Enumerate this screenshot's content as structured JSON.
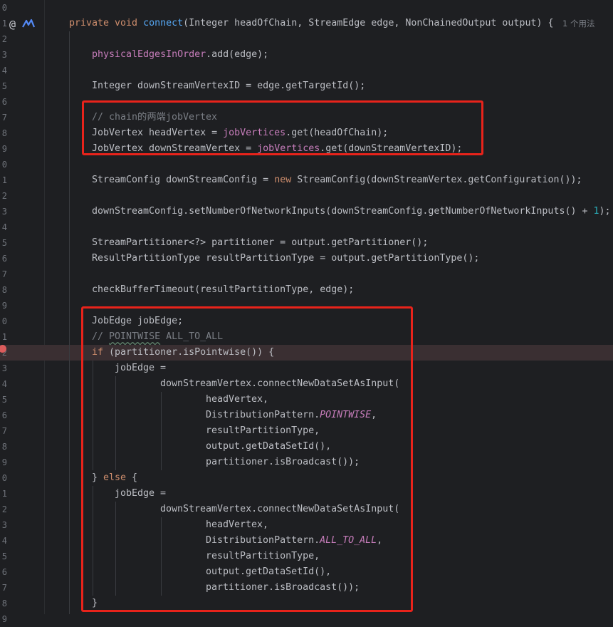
{
  "editor": {
    "usage_hint": "1 个用法",
    "lines": [
      {
        "no": "0",
        "indent": 0,
        "tokens": []
      },
      {
        "no": "1",
        "indent": 1,
        "tokens": [
          {
            "t": "k",
            "v": "private void "
          },
          {
            "t": "f",
            "v": "connect"
          },
          {
            "t": "",
            "v": "(Integer headOfChain, StreamEdge edge, NonChainedOutput output) {"
          }
        ]
      },
      {
        "no": "2",
        "indent": 0,
        "tokens": []
      },
      {
        "no": "3",
        "indent": 2,
        "tokens": [
          {
            "t": "p",
            "v": "physicalEdgesInOrder"
          },
          {
            "t": "",
            "v": ".add(edge);"
          }
        ]
      },
      {
        "no": "4",
        "indent": 0,
        "tokens": []
      },
      {
        "no": "5",
        "indent": 2,
        "tokens": [
          {
            "t": "",
            "v": "Integer downStreamVertexID = edge.getTargetId();"
          }
        ]
      },
      {
        "no": "6",
        "indent": 0,
        "tokens": []
      },
      {
        "no": "7",
        "indent": 2,
        "tokens": [
          {
            "t": "c",
            "v": "// chain的两端jobVertex"
          }
        ]
      },
      {
        "no": "8",
        "indent": 2,
        "tokens": [
          {
            "t": "",
            "v": "JobVertex headVertex = "
          },
          {
            "t": "p",
            "v": "jobVertices"
          },
          {
            "t": "",
            "v": ".get(headOfChain);"
          }
        ]
      },
      {
        "no": "9",
        "indent": 2,
        "tokens": [
          {
            "t": "",
            "v": "JobVertex downStreamVertex = "
          },
          {
            "t": "p",
            "v": "jobVertices"
          },
          {
            "t": "",
            "v": ".get(downStreamVertexID);"
          }
        ]
      },
      {
        "no": "0",
        "indent": 0,
        "tokens": []
      },
      {
        "no": "1",
        "indent": 2,
        "tokens": [
          {
            "t": "",
            "v": "StreamConfig downStreamConfig = "
          },
          {
            "t": "k",
            "v": "new "
          },
          {
            "t": "",
            "v": "StreamConfig(downStreamVertex.getConfiguration());"
          }
        ]
      },
      {
        "no": "2",
        "indent": 0,
        "tokens": []
      },
      {
        "no": "3",
        "indent": 2,
        "tokens": [
          {
            "t": "",
            "v": "downStreamConfig.setNumberOfNetworkInputs(downStreamConfig.getNumberOfNetworkInputs() + "
          },
          {
            "t": "n",
            "v": "1"
          },
          {
            "t": "",
            "v": ");"
          }
        ]
      },
      {
        "no": "4",
        "indent": 0,
        "tokens": []
      },
      {
        "no": "5",
        "indent": 2,
        "tokens": [
          {
            "t": "",
            "v": "StreamPartitioner<?> partitioner = output.getPartitioner();"
          }
        ]
      },
      {
        "no": "6",
        "indent": 2,
        "tokens": [
          {
            "t": "",
            "v": "ResultPartitionType resultPartitionType = output.getPartitionType();"
          }
        ]
      },
      {
        "no": "7",
        "indent": 0,
        "tokens": []
      },
      {
        "no": "8",
        "indent": 2,
        "tokens": [
          {
            "t": "",
            "v": "checkBufferTimeout(resultPartitionType, edge);"
          }
        ]
      },
      {
        "no": "9",
        "indent": 0,
        "tokens": []
      },
      {
        "no": "0",
        "indent": 2,
        "tokens": [
          {
            "t": "",
            "v": "JobEdge jobEdge;"
          }
        ]
      },
      {
        "no": "1",
        "indent": 2,
        "tokens": [
          {
            "t": "c",
            "v": "// "
          },
          {
            "t": "c wave",
            "v": "POINTWISE"
          },
          {
            "t": "c",
            "v": " ALL_TO_ALL"
          }
        ]
      },
      {
        "no": "2",
        "indent": 2,
        "active": true,
        "tokens": [
          {
            "t": "k",
            "v": "if "
          },
          {
            "t": "",
            "v": "(partitioner.isPointwise()) {"
          }
        ]
      },
      {
        "no": "3",
        "indent": 3,
        "tokens": [
          {
            "t": "",
            "v": "jobEdge ="
          }
        ]
      },
      {
        "no": "4",
        "indent": 5,
        "tokens": [
          {
            "t": "",
            "v": "downStreamVertex.connectNewDataSetAsInput("
          }
        ]
      },
      {
        "no": "5",
        "indent": 7,
        "tokens": [
          {
            "t": "",
            "v": "headVertex,"
          }
        ]
      },
      {
        "no": "6",
        "indent": 7,
        "tokens": [
          {
            "t": "",
            "v": "DistributionPattern."
          },
          {
            "t": "s",
            "v": "POINTWISE"
          },
          {
            "t": "",
            "v": ","
          }
        ]
      },
      {
        "no": "7",
        "indent": 7,
        "tokens": [
          {
            "t": "",
            "v": "resultPartitionType,"
          }
        ]
      },
      {
        "no": "8",
        "indent": 7,
        "tokens": [
          {
            "t": "",
            "v": "output.getDataSetId(),"
          }
        ]
      },
      {
        "no": "9",
        "indent": 7,
        "tokens": [
          {
            "t": "",
            "v": "partitioner.isBroadcast());"
          }
        ]
      },
      {
        "no": "0",
        "indent": 2,
        "tokens": [
          {
            "t": "",
            "v": "} "
          },
          {
            "t": "k",
            "v": "else "
          },
          {
            "t": "",
            "v": "{"
          }
        ]
      },
      {
        "no": "1",
        "indent": 3,
        "tokens": [
          {
            "t": "",
            "v": "jobEdge ="
          }
        ]
      },
      {
        "no": "2",
        "indent": 5,
        "tokens": [
          {
            "t": "",
            "v": "downStreamVertex.connectNewDataSetAsInput("
          }
        ]
      },
      {
        "no": "3",
        "indent": 7,
        "tokens": [
          {
            "t": "",
            "v": "headVertex,"
          }
        ]
      },
      {
        "no": "4",
        "indent": 7,
        "tokens": [
          {
            "t": "",
            "v": "DistributionPattern."
          },
          {
            "t": "s",
            "v": "ALL_TO_ALL"
          },
          {
            "t": "",
            "v": ","
          }
        ]
      },
      {
        "no": "5",
        "indent": 7,
        "tokens": [
          {
            "t": "",
            "v": "resultPartitionType,"
          }
        ]
      },
      {
        "no": "6",
        "indent": 7,
        "tokens": [
          {
            "t": "",
            "v": "output.getDataSetId(),"
          }
        ]
      },
      {
        "no": "7",
        "indent": 7,
        "tokens": [
          {
            "t": "",
            "v": "partitioner.isBroadcast());"
          }
        ]
      },
      {
        "no": "8",
        "indent": 2,
        "tokens": [
          {
            "t": "",
            "v": "}"
          }
        ]
      },
      {
        "no": "9",
        "indent": 0,
        "tokens": []
      }
    ]
  },
  "gutter_icons": [
    "annotation-at-icon",
    "implementation-icon",
    "breakpoint-icon"
  ],
  "colors": {
    "background": "#1e1f22",
    "keyword": "#cf8e6d",
    "method_decl": "#56a8f5",
    "field": "#c77dbb",
    "comment": "#7a7e85",
    "number": "#2aacb8",
    "highlight_box": "#e8231b",
    "active_line": "#3a2f32",
    "breakpoint": "#db5c5c"
  }
}
